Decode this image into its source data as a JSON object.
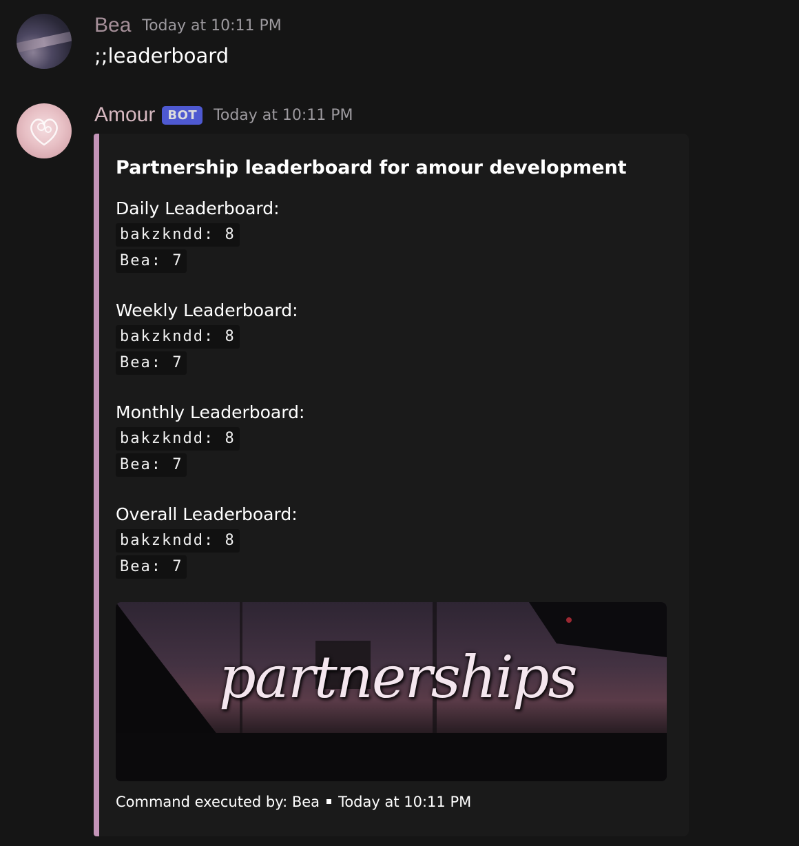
{
  "messages": [
    {
      "username": "Bea",
      "timestamp": "Today at 10:11 PM",
      "content": ";;leaderboard",
      "avatar_icon": "user-avatar"
    },
    {
      "username": "Amour",
      "bot_tag": "BOT",
      "timestamp": "Today at 10:11 PM",
      "avatar_icon": "heart-logo-avatar",
      "embed": {
        "accent_color": "#c494b8",
        "title": "Partnership leaderboard for amour development",
        "sections": [
          {
            "title": "Daily Leaderboard:",
            "entries": [
              "bakzkndd: 8",
              "Bea: 7"
            ]
          },
          {
            "title": "Weekly Leaderboard:",
            "entries": [
              "bakzkndd: 8",
              "Bea: 7"
            ]
          },
          {
            "title": "Monthly Leaderboard:",
            "entries": [
              "bakzkndd: 8",
              "Bea: 7"
            ]
          },
          {
            "title": "Overall Leaderboard:",
            "entries": [
              "bakzkndd: 8",
              "Bea: 7"
            ]
          }
        ],
        "image_text": "partnerships",
        "footer_text": "Command executed by: Bea",
        "footer_timestamp": "Today at 10:11 PM"
      }
    }
  ],
  "colors": {
    "background": "#151515",
    "embed_background": "#1a1a1a",
    "bot_tag": "#5865f2",
    "username_bea": "#a58f99",
    "username_amour": "#d6b8c0"
  }
}
